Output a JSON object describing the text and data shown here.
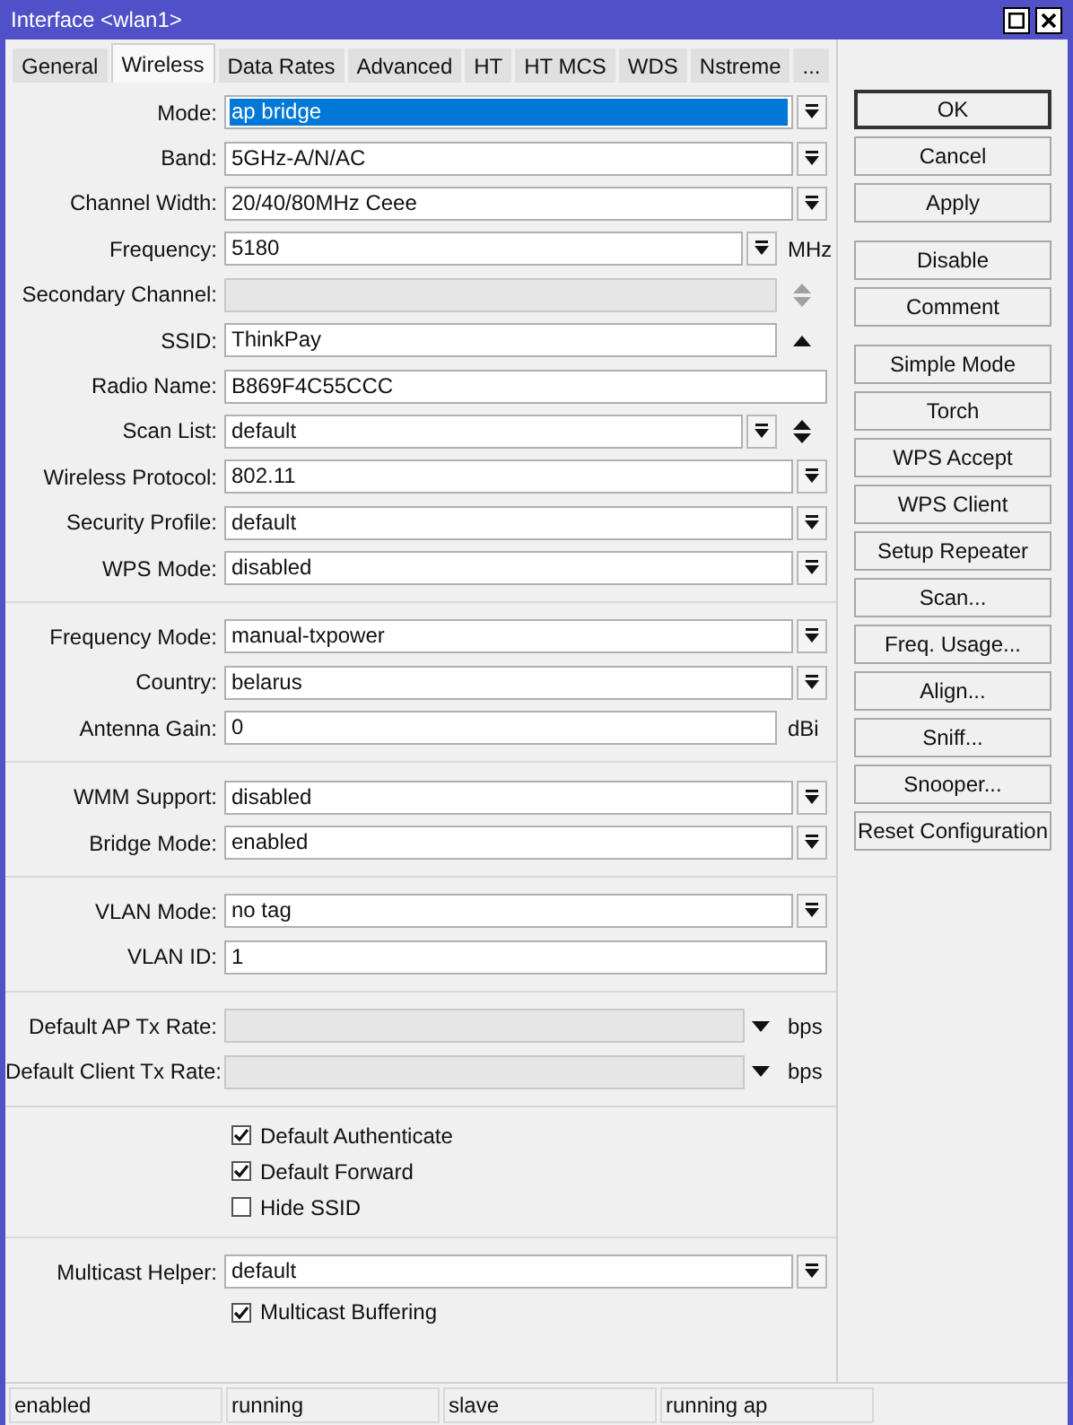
{
  "window": {
    "title": "Interface <wlan1>"
  },
  "tabs": [
    {
      "label": "General",
      "selected": false
    },
    {
      "label": "Wireless",
      "selected": true
    },
    {
      "label": "Data Rates",
      "selected": false
    },
    {
      "label": "Advanced",
      "selected": false
    },
    {
      "label": "HT",
      "selected": false
    },
    {
      "label": "HT MCS",
      "selected": false
    },
    {
      "label": "WDS",
      "selected": false
    },
    {
      "label": "Nstreme",
      "selected": false
    },
    {
      "label": "...",
      "selected": false
    }
  ],
  "sections": [
    {
      "rows": [
        {
          "kind": "select",
          "label": "Mode:",
          "value": "ap bridge",
          "highlighted": true
        },
        {
          "kind": "select",
          "label": "Band:",
          "value": "5GHz-A/N/AC",
          "highlighted": false
        },
        {
          "kind": "select",
          "label": "Channel Width:",
          "value": "20/40/80MHz Ceee",
          "highlighted": false
        },
        {
          "kind": "select_unit",
          "label": "Frequency:",
          "value": "5180",
          "unit": "MHz"
        },
        {
          "kind": "disabled_spin",
          "label": "Secondary Channel:"
        },
        {
          "kind": "text_up",
          "label": "SSID:",
          "value": "ThinkPay"
        },
        {
          "kind": "text",
          "label": "Radio Name:",
          "value": "B869F4C55CCC"
        },
        {
          "kind": "select_spin",
          "label": "Scan List:",
          "value": "default"
        },
        {
          "kind": "select",
          "label": "Wireless Protocol:",
          "value": "802.11",
          "highlighted": false
        },
        {
          "kind": "select",
          "label": "Security Profile:",
          "value": "default",
          "highlighted": false
        },
        {
          "kind": "select",
          "label": "WPS Mode:",
          "value": "disabled",
          "highlighted": false
        }
      ]
    },
    {
      "rows": [
        {
          "kind": "select",
          "label": "Frequency Mode:",
          "value": "manual-txpower",
          "highlighted": false
        },
        {
          "kind": "select",
          "label": "Country:",
          "value": "belarus",
          "highlighted": false
        },
        {
          "kind": "text_unit",
          "label": "Antenna Gain:",
          "value": "0",
          "unit": "dBi"
        }
      ]
    },
    {
      "rows": [
        {
          "kind": "select",
          "label": "WMM Support:",
          "value": "disabled",
          "highlighted": false
        },
        {
          "kind": "select",
          "label": "Bridge Mode:",
          "value": "enabled",
          "highlighted": false
        }
      ]
    },
    {
      "rows": [
        {
          "kind": "select",
          "label": "VLAN Mode:",
          "value": "no tag",
          "highlighted": false
        },
        {
          "kind": "text",
          "label": "VLAN ID:",
          "value": "1"
        }
      ]
    },
    {
      "rows": [
        {
          "kind": "disabled_rate",
          "label": "Default AP Tx Rate:",
          "unit": "bps"
        },
        {
          "kind": "disabled_rate",
          "label": "Default Client Tx Rate:",
          "unit": "bps"
        }
      ]
    },
    {
      "rows": [
        {
          "kind": "checkbox",
          "label": "Default Authenticate",
          "checked": true
        },
        {
          "kind": "checkbox",
          "label": "Default Forward",
          "checked": true
        },
        {
          "kind": "checkbox",
          "label": "Hide SSID",
          "checked": false
        }
      ]
    },
    {
      "rows": [
        {
          "kind": "select",
          "label": "Multicast Helper:",
          "value": "default",
          "highlighted": false
        },
        {
          "kind": "checkbox",
          "label": "Multicast Buffering",
          "checked": true
        }
      ]
    }
  ],
  "button_groups": [
    [
      {
        "label": "OK",
        "default": true
      },
      {
        "label": "Cancel",
        "default": false
      },
      {
        "label": "Apply",
        "default": false
      }
    ],
    [
      {
        "label": "Disable",
        "default": false
      },
      {
        "label": "Comment",
        "default": false
      }
    ],
    [
      {
        "label": "Simple Mode",
        "default": false
      },
      {
        "label": "Torch",
        "default": false
      },
      {
        "label": "WPS Accept",
        "default": false
      },
      {
        "label": "WPS Client",
        "default": false
      },
      {
        "label": "Setup Repeater",
        "default": false
      },
      {
        "label": "Scan...",
        "default": false
      },
      {
        "label": "Freq. Usage...",
        "default": false
      },
      {
        "label": "Align...",
        "default": false
      },
      {
        "label": "Sniff...",
        "default": false
      },
      {
        "label": "Snooper...",
        "default": false
      },
      {
        "label": "Reset Configuration",
        "default": false
      }
    ]
  ],
  "status_bar": [
    "enabled",
    "running",
    "slave",
    "running ap"
  ]
}
